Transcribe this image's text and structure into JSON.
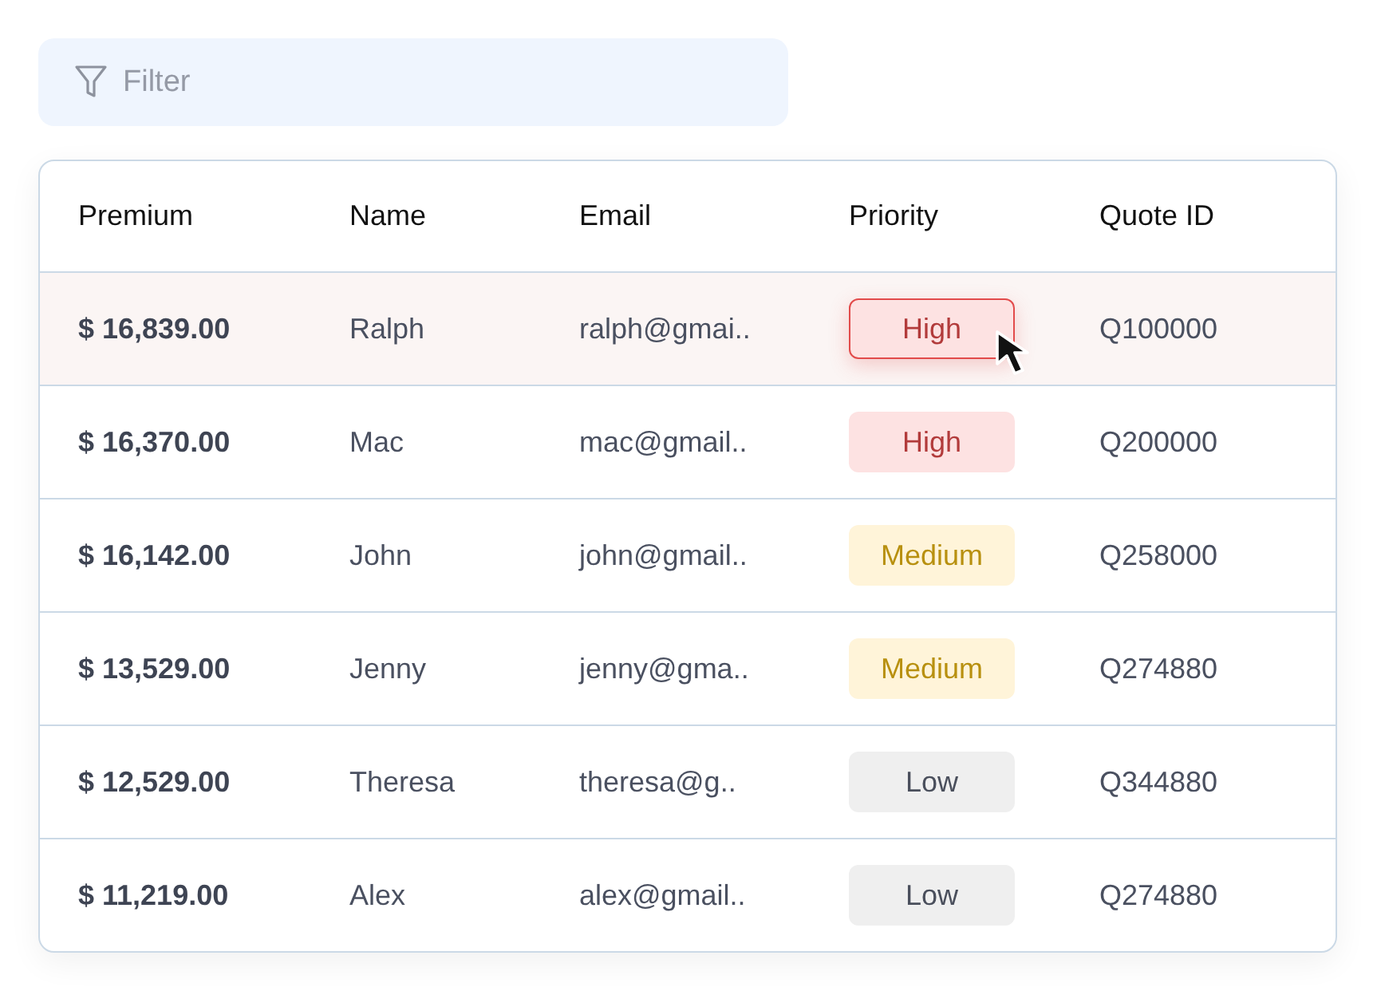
{
  "filter": {
    "placeholder": "Filter"
  },
  "table": {
    "columns": [
      "Premium",
      "Name",
      "Email",
      "Priority",
      "Quote ID"
    ],
    "rows": [
      {
        "premium": "$ 16,839.00",
        "name": "Ralph",
        "email": "ralph@gmai..",
        "priority": {
          "label": "High",
          "kind": "high"
        },
        "quote_id": "Q100000",
        "hovered": true
      },
      {
        "premium": "$ 16,370.00",
        "name": "Mac",
        "email": "mac@gmail..",
        "priority": {
          "label": "High",
          "kind": "high"
        },
        "quote_id": "Q200000",
        "hovered": false
      },
      {
        "premium": "$ 16,142.00",
        "name": "John",
        "email": "john@gmail..",
        "priority": {
          "label": "Medium",
          "kind": "medium"
        },
        "quote_id": "Q258000",
        "hovered": false
      },
      {
        "premium": "$ 13,529.00",
        "name": "Jenny",
        "email": "jenny@gma..",
        "priority": {
          "label": "Medium",
          "kind": "medium"
        },
        "quote_id": "Q274880",
        "hovered": false
      },
      {
        "premium": "$ 12,529.00",
        "name": "Theresa",
        "email": "theresa@g..",
        "priority": {
          "label": "Low",
          "kind": "low"
        },
        "quote_id": "Q344880",
        "hovered": false
      },
      {
        "premium": "$ 11,219.00",
        "name": "Alex",
        "email": "alex@gmail..",
        "priority": {
          "label": "Low",
          "kind": "low"
        },
        "quote_id": "Q274880",
        "hovered": false
      }
    ]
  }
}
